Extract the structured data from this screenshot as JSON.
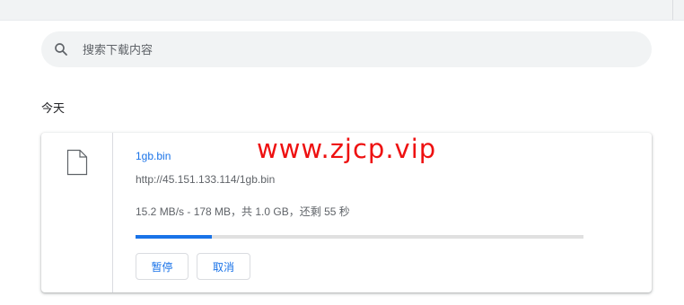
{
  "search": {
    "placeholder": "搜索下载内容",
    "icon": "search-icon"
  },
  "downloads": {
    "date_header": "今天",
    "items": [
      {
        "file_icon": "file-icon",
        "name": "1gb.bin",
        "url": "http://45.151.133.114/1gb.bin",
        "status": "15.2 MB/s - 178 MB，共 1.0 GB，还剩 55 秒",
        "progress": 0.17,
        "buttons": {
          "pause_label": "暂停",
          "cancel_label": "取消"
        }
      }
    ]
  },
  "watermark": {
    "text": "www.zjcp.vip"
  },
  "colors": {
    "accent": "#1a73e8",
    "watermark": "#ee1111",
    "progress_track": "#e0e0e0"
  }
}
